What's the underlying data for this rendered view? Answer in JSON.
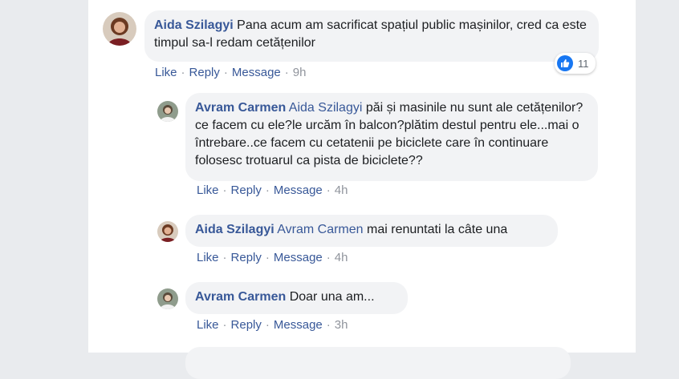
{
  "comments": [
    {
      "author": "Aida Szilagyi",
      "text": "Pana acum am sacrificat spațiul public mașinilor, cred ca este timpul sa-l redam cetățenilor",
      "actions": {
        "like": "Like",
        "reply": "Reply",
        "message": "Message",
        "time": "9h"
      },
      "reaction_count": "11"
    }
  ],
  "replies": [
    {
      "author": "Avram Carmen",
      "mention": "Aida Szilagyi",
      "text": "păi și masinile nu sunt ale cetățenilor?ce facem cu ele?le urcăm în balcon?plătim destul pentru ele...mai o întrebare..ce facem cu cetatenii pe biciclete care în continuare folosesc trotuarul ca pista de biciclete??",
      "actions": {
        "like": "Like",
        "reply": "Reply",
        "message": "Message",
        "time": "4h"
      }
    },
    {
      "author": "Aida Szilagyi",
      "mention": "Avram Carmen",
      "text": "mai renuntati la câte una",
      "actions": {
        "like": "Like",
        "reply": "Reply",
        "message": "Message",
        "time": "4h"
      }
    },
    {
      "author": "Avram Carmen",
      "text": "Doar una am...",
      "actions": {
        "like": "Like",
        "reply": "Reply",
        "message": "Message",
        "time": "3h"
      }
    }
  ],
  "colors": {
    "link": "#385898",
    "bubble": "#f2f3f5",
    "like_blue": "#1877f2",
    "meta_gray": "#90949c"
  }
}
